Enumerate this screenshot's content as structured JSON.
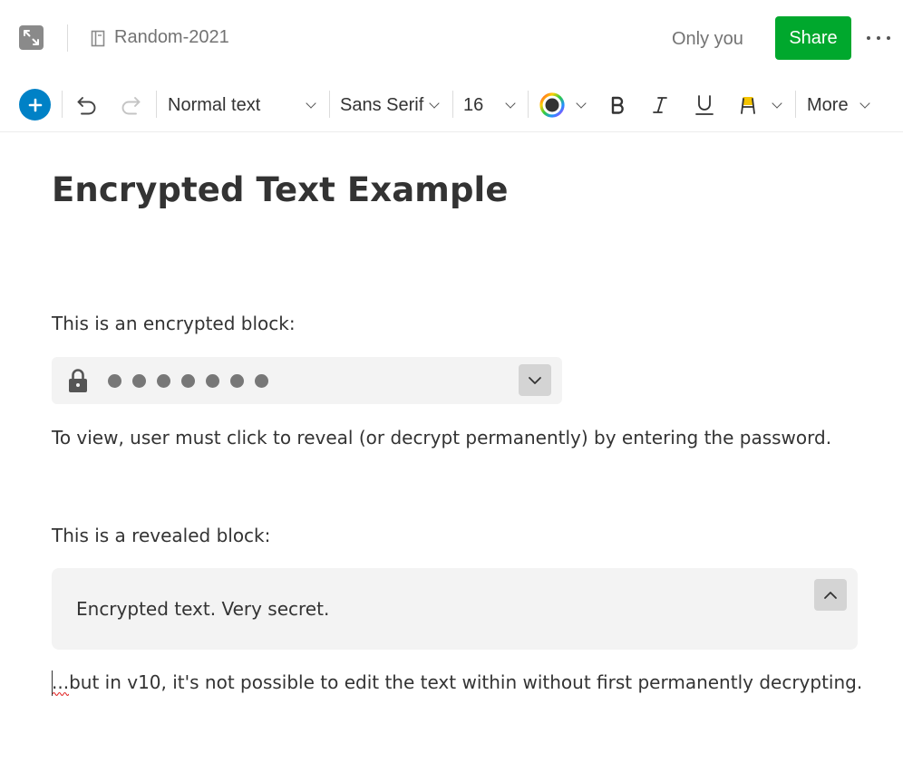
{
  "header": {
    "note_title": "Random-2021",
    "sharing_status": "Only you",
    "share_label": "Share"
  },
  "toolbar": {
    "block_style": "Normal text",
    "font_family": "Sans Serif",
    "font_size": "16",
    "more_label": "More",
    "highlight_color": "#f5c400",
    "add_button_color": "#0081c6"
  },
  "document": {
    "title": "Encrypted Text Example",
    "encrypted_intro": "This is an encrypted block:",
    "view_instruction": "To view, user must click to reveal (or decrypt permanently) by entering the password.",
    "revealed_intro": "This is a revealed block:",
    "revealed_text": "Encrypted text. Very secret.",
    "final_note": "...but in v10, it's not possible to edit the text within without first permanently decrypting."
  },
  "icons": {
    "expand": "expand-icon",
    "note": "note-icon",
    "undo": "undo-icon",
    "redo": "redo-icon",
    "color": "color-wheel-icon",
    "bold": "bold-icon",
    "italic": "italic-icon",
    "underline": "underline-icon",
    "highlight": "highlighter-icon",
    "lock": "lock-icon"
  },
  "colors": {
    "share_button": "#00a82d",
    "block_background": "#f3f3f3"
  }
}
